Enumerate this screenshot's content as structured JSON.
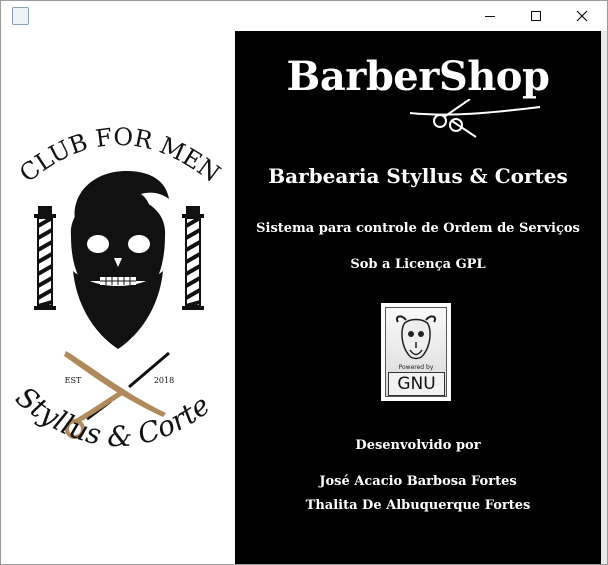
{
  "window": {
    "title": "",
    "controls": {
      "minimize_icon": "minimize-icon",
      "maximize_icon": "maximize-icon",
      "close_icon": "close-icon"
    }
  },
  "logo": {
    "top_text": "CLUB FOR MEN",
    "est_label": "EST",
    "est_year": "2018",
    "bottom_text": "Styllus & Cortes",
    "colors": {
      "ink": "#111111",
      "bronze": "#b08a5a"
    }
  },
  "about": {
    "shop_title": "BarberShop",
    "business_name": "Barbearia Styllus & Cortes",
    "system_description": "Sistema para controle de Ordem de Serviços",
    "license": "Sob a Licença GPL",
    "gnu_badge": {
      "powered_by": "Powered by",
      "word": "GNU"
    },
    "developed_by": "Desenvolvido por",
    "developers": [
      "José Acacio Barbosa Fortes",
      "Thalita De Albuquerque Fortes"
    ]
  }
}
